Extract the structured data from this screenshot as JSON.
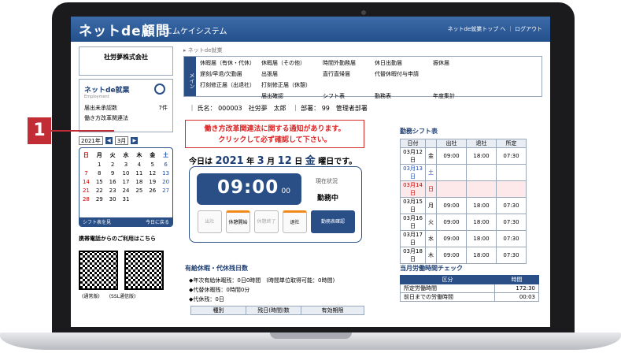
{
  "header": {
    "logo": "ネットde顧問",
    "system_name": "エムケイシステム",
    "links": "ネットde就業トップ へ ｜ ログアウト"
  },
  "sidebar": {
    "company": "社労夢株式会社",
    "app_logo": "ネットde就業",
    "app_sub": "Employment",
    "unapproved_label": "届出未承認数",
    "unapproved_count": "7件",
    "reform_label": "働き方改革関連法",
    "year_select": "2021年",
    "month_select": "3月",
    "calendar_days": [
      "日",
      "月",
      "火",
      "水",
      "木",
      "金",
      "土"
    ],
    "calendar_weeks": [
      [
        "",
        "1",
        "2",
        "3",
        "4",
        "5",
        "6"
      ],
      [
        "7",
        "8",
        "9",
        "10",
        "11",
        "12",
        "13"
      ],
      [
        "14",
        "15",
        "16",
        "17",
        "18",
        "19",
        "20"
      ],
      [
        "21",
        "22",
        "23",
        "24",
        "25",
        "26",
        "27"
      ],
      [
        "28",
        "29",
        "30",
        "31",
        "",
        "",
        ""
      ]
    ],
    "cal_foot_left": "シフト表を見",
    "cal_foot_right": "今日に戻る",
    "mobile_title": "携帯電話からのご利用はこちら",
    "qr_label_1": "(通常版)",
    "qr_label_2": "(SSL通信版)"
  },
  "main": {
    "breadcrumb": "ネットde就業",
    "menu_tab": "メイン",
    "menu_items": [
      "休暇届（有休・代休）",
      "休暇届（その他）",
      "時間外勤務届",
      "休日出勤届",
      "振休届",
      "遅刻/早退/欠勤届",
      "出張届",
      "直行直帰届",
      "代替休暇付与申請",
      "",
      "打刻修正届（出退社）",
      "打刻修正届（休憩）",
      "",
      "",
      "",
      "",
      "届出確認",
      "シフト表",
      "勤務表",
      "年度集計"
    ],
    "employee": "｜ 氏名： 000003　社労夢　太郎　｜ 部署： 99　管理者部署",
    "notice_line1": "働き方改革関連法に関する通知があります。",
    "notice_line2": "クリックして必ず確認して下さい。",
    "today_prefix": "今日は",
    "today_year": "2021",
    "today_year_unit": "年",
    "today_month": "3",
    "today_month_unit": "月",
    "today_day": "12",
    "today_day_unit": "日",
    "today_wday": "金",
    "today_suffix": "曜日です。",
    "time_main": "09:00",
    "time_sec": "00",
    "status_label": "現在状況",
    "status_value": "勤務中",
    "btn_in": "出社",
    "btn_break_start": "休憩開始",
    "btn_break_end": "休憩終了",
    "btn_out": "退社",
    "btn_confirm": "勤務表確認"
  },
  "shift": {
    "title": "勤務シフト表",
    "headers": [
      "日付",
      "",
      "出社",
      "退社",
      "所定"
    ],
    "rows": [
      [
        "03月12日",
        "金",
        "09:00",
        "18:00",
        "07:30"
      ],
      [
        "03月13日",
        "土",
        "",
        "",
        ""
      ],
      [
        "03月14日",
        "日",
        "",
        "",
        ""
      ],
      [
        "03月15日",
        "月",
        "09:00",
        "18:00",
        "07:30"
      ],
      [
        "03月16日",
        "火",
        "09:00",
        "18:00",
        "07:30"
      ],
      [
        "03月17日",
        "水",
        "09:00",
        "18:00",
        "07:30"
      ],
      [
        "03月18日",
        "木",
        "09:00",
        "18:00",
        "07:30"
      ]
    ]
  },
  "leave": {
    "title": "有給休暇・代休残日数",
    "line1": "◆年次有給休暇残：0日0時間　(時間単位取得可能：0時間)",
    "line2": "◆代替休暇残：0時間0分",
    "line3": "◆代休残：0日",
    "headers": [
      "種別",
      "残日(時間)数",
      "有効期限"
    ]
  },
  "monthly": {
    "title": "当月労働時間チェック",
    "headers": [
      "区分",
      "時間"
    ],
    "rows": [
      [
        "所定労働時間",
        "172:30"
      ],
      [
        "前日までの労働時間",
        "00:03"
      ]
    ]
  },
  "callout": {
    "number": "1"
  },
  "colors": {
    "brand": "#2a4f86",
    "alert": "#d22222",
    "callout": "#c22c34"
  }
}
